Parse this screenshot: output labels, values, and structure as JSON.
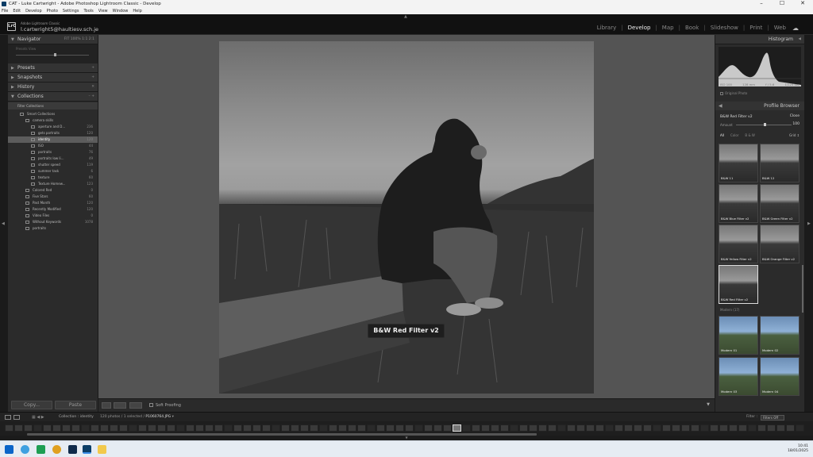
{
  "window": {
    "title": "CAT - Luke Cartwright - Adobe Photoshop Lightroom Classic - Develop",
    "controls": [
      "–",
      "☐",
      "✕"
    ]
  },
  "menu": [
    "File",
    "Edit",
    "Develop",
    "Photo",
    "Settings",
    "Tools",
    "View",
    "Window",
    "Help"
  ],
  "identity": {
    "logo": "LrC",
    "app_name": "Adobe Lightroom Classic",
    "email": "l.cartwright5@haultiesv.sch.je"
  },
  "modules": [
    "Library",
    "Develop",
    "Map",
    "Book",
    "Slideshow",
    "Print",
    "Web"
  ],
  "active_module": "Develop",
  "left_panel": {
    "navigator": {
      "title": "Navigator",
      "zoom_options": "FIT  100%  1:1  2:1",
      "preview_text": "Presets  View"
    },
    "presets": "Presets",
    "snapshots": "Snapshots",
    "history": "History",
    "collections": {
      "title": "Collections",
      "add": "–  +"
    },
    "filter": "Filter Collections",
    "items": [
      {
        "label": "Smart Collections",
        "count": "",
        "indent": 1
      },
      {
        "label": "camera skills",
        "count": "",
        "indent": 2
      },
      {
        "label": "aperture and D...",
        "count": "236",
        "indent": 3
      },
      {
        "label": "gets portraits",
        "count": "120",
        "indent": 3
      },
      {
        "label": "identity",
        "count": "120",
        "indent": 3,
        "selected": true
      },
      {
        "label": "ISO",
        "count": "44",
        "indent": 3
      },
      {
        "label": "portraits",
        "count": "76",
        "indent": 3
      },
      {
        "label": "portraits low li...",
        "count": "49",
        "indent": 3
      },
      {
        "label": "shutter speed",
        "count": "119",
        "indent": 3
      },
      {
        "label": "summer task",
        "count": "6",
        "indent": 3
      },
      {
        "label": "texture",
        "count": "60",
        "indent": 3
      },
      {
        "label": "Texture Homew...",
        "count": "123",
        "indent": 3
      },
      {
        "label": "Colored Red",
        "count": "0",
        "indent": 2
      },
      {
        "label": "Five Stars",
        "count": "60",
        "indent": 2
      },
      {
        "label": "Past Month",
        "count": "120",
        "indent": 2
      },
      {
        "label": "Recently Modified",
        "count": "120",
        "indent": 2
      },
      {
        "label": "Video Files",
        "count": "0",
        "indent": 2
      },
      {
        "label": "Without Keywords",
        "count": "1078",
        "indent": 2
      },
      {
        "label": "portraits",
        "count": "",
        "indent": 2
      }
    ],
    "copy": "Copy...",
    "paste": "Paste"
  },
  "image_overlay": "B&W Red Filter v2",
  "toolbar": {
    "soft_proofing": "Soft Proofing"
  },
  "right_panel": {
    "histogram_title": "Histogram",
    "histo_info": [
      "ISO 100",
      "128 mm",
      "f / 5.6",
      "1/125 sec"
    ],
    "original_photo": "Original Photo",
    "profile_browser": "Profile Browser",
    "profile_name": "B&W Red Filter v2",
    "close": "Close",
    "amount_label": "Amount",
    "amount_value": "100",
    "amount_fraction": 0.5,
    "filter_tabs": [
      "All",
      "Color",
      "B & W"
    ],
    "grid": "Grid ↕",
    "thumbs": [
      {
        "label": "B&W 11"
      },
      {
        "label": "B&W 12"
      },
      {
        "label": "B&W Blue Filter v2"
      },
      {
        "label": "B&W Green Filter v2"
      },
      {
        "label": "B&W Yellow Filter v2"
      },
      {
        "label": "B&W Orange Filter v2"
      },
      {
        "label": "B&W Red Filter v2",
        "selected": true
      }
    ],
    "modern_header": "Modern (17)",
    "modern_thumbs": [
      {
        "label": "Modern 01"
      },
      {
        "label": "Modern 02"
      },
      {
        "label": "Modern 03"
      },
      {
        "label": "Modern 04"
      }
    ]
  },
  "filmstrip": {
    "collection": "Collection : identity",
    "count_text": "120 photos / 1 selected /",
    "file": "P1060764.JPG",
    "filter_label": "Filter :",
    "filter_value": "Filters Off"
  },
  "taskbar": {
    "time": "10:41",
    "date": "18/01/2025"
  }
}
